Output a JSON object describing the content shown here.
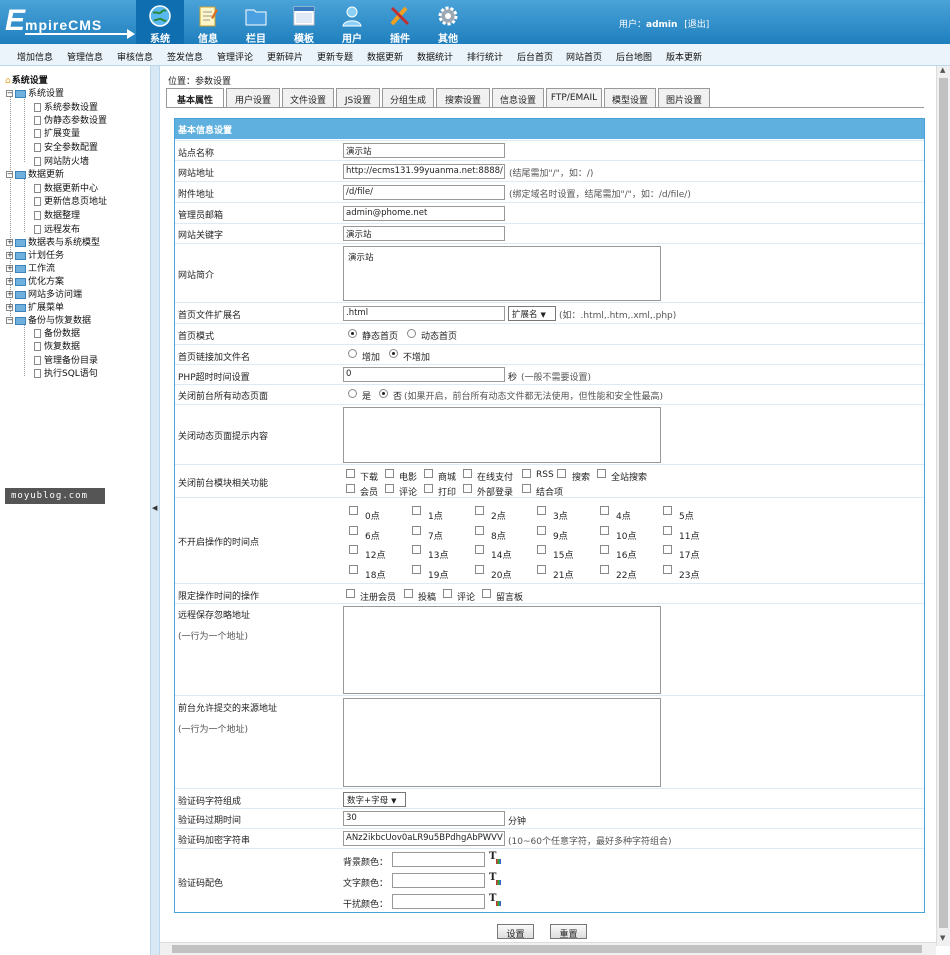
{
  "logo": {
    "big": "E",
    "small": "mpireCMS"
  },
  "topnav": [
    {
      "label": "系统",
      "icon": "globe-icon",
      "active": true
    },
    {
      "label": "信息",
      "icon": "notepad-icon"
    },
    {
      "label": "栏目",
      "icon": "folder-icon"
    },
    {
      "label": "模板",
      "icon": "window-icon"
    },
    {
      "label": "用户",
      "icon": "user-icon"
    },
    {
      "label": "插件",
      "icon": "tools-icon"
    },
    {
      "label": "其他",
      "icon": "gear-icon"
    }
  ],
  "user": {
    "prefix": "用户：",
    "name": "admin",
    "logout": "[退出]"
  },
  "menubar": [
    "增加信息",
    "管理信息",
    "审核信息",
    "签发信息",
    "管理评论",
    "更新碎片",
    "更新专题",
    "数据更新",
    "数据统计",
    "排行统计",
    "后台首页",
    "网站首页",
    "后台地图",
    "版本更新"
  ],
  "sidebar": {
    "root": "系统设置",
    "groups": [
      {
        "label": "系统设置",
        "open": true,
        "items": [
          "系统参数设置",
          "伪静态参数设置",
          "扩展变量",
          "安全参数配置",
          "网站防火墙"
        ]
      },
      {
        "label": "数据更新",
        "open": true,
        "items": [
          "数据更新中心",
          "更新信息页地址",
          "数据整理",
          "远程发布"
        ]
      },
      {
        "label": "数据表与系统模型"
      },
      {
        "label": "计划任务"
      },
      {
        "label": "工作流"
      },
      {
        "label": "优化方案"
      },
      {
        "label": "网站多访问端"
      },
      {
        "label": "扩展菜单"
      },
      {
        "label": "备份与恢复数据",
        "open": true,
        "items": [
          "备份数据",
          "恢复数据",
          "管理备份目录",
          "执行SQL语句"
        ]
      }
    ],
    "watermark": "moyublog.com"
  },
  "location": "位置：参数设置",
  "tabs": [
    "基本属性",
    "用户设置",
    "文件设置",
    "JS设置",
    "分组生成",
    "搜索设置",
    "信息设置",
    "FTP/EMAIL",
    "模型设置",
    "图片设置"
  ],
  "form": {
    "title": "基本信息设置",
    "site_name": {
      "label": "站点名称",
      "value": "演示站"
    },
    "site_url": {
      "label": "网站地址",
      "value": "http://ecms131.99yuanma.net:8888/",
      "hint": "(结尾需加\"/\"，如：/)"
    },
    "file_url": {
      "label": "附件地址",
      "value": "/d/file/",
      "hint": "(绑定域名时设置，结尾需加\"/\"，如：/d/file/)"
    },
    "email": {
      "label": "管理员邮箱",
      "value": "admin@phome.net"
    },
    "keywords": {
      "label": "网站关键字",
      "value": "演示站"
    },
    "intro": {
      "label": "网站简介",
      "value": "演示站"
    },
    "index_ext": {
      "label": "首页文件扩展名",
      "value": ".html",
      "select": "扩展名",
      "hint": "(如：.html,.htm,.xml,.php)"
    },
    "index_mode": {
      "label": "首页模式",
      "opt1": "静态首页",
      "opt2": "动态首页"
    },
    "index_link": {
      "label": "首页链接加文件名",
      "opt1": "增加",
      "opt2": "不增加"
    },
    "php_timeout": {
      "label": "PHP超时时间设置",
      "value": "0",
      "unit": "秒",
      "hint": "(一般不需要设置)"
    },
    "close_dynamic": {
      "label": "关闭前台所有动态页面",
      "opt1": "是",
      "opt2": "否",
      "hint": "(如果开启，前台所有动态文件都无法使用，但性能和安全性最高)"
    },
    "close_msg": {
      "label": "关闭动态页面提示内容"
    },
    "close_modules": {
      "label": "关闭前台模块相关功能",
      "row1": [
        "下载",
        "电影",
        "商城",
        "在线支付",
        "RSS",
        "搜索",
        "全站搜索"
      ],
      "row2": [
        "会员",
        "评论",
        "打印",
        "外部登录",
        "结合项"
      ]
    },
    "closed_hours": {
      "label": "不开启操作的时间点",
      "hours": [
        "0点",
        "1点",
        "2点",
        "3点",
        "4点",
        "5点",
        "6点",
        "7点",
        "8点",
        "9点",
        "10点",
        "11点",
        "12点",
        "13点",
        "14点",
        "15点",
        "16点",
        "17点",
        "18点",
        "19点",
        "20点",
        "21点",
        "22点",
        "23点"
      ]
    },
    "limit_ops": {
      "label": "限定操作时间的操作",
      "opts": [
        "注册会员",
        "投稿",
        "评论",
        "留言板"
      ]
    },
    "remote_ignore": {
      "label": "远程保存忽略地址",
      "sub": "(一行为一个地址)"
    },
    "allow_source": {
      "label": "前台允许提交的来源地址",
      "sub": "(一行为一个地址)"
    },
    "captcha_chars": {
      "label": "验证码字符组成",
      "select": "数字+字母"
    },
    "captcha_expire": {
      "label": "验证码过期时间",
      "value": "30",
      "unit": "分钟"
    },
    "captcha_key": {
      "label": "验证码加密字符串",
      "value": "ANz2ikbcUov0aLR9u5BPdhgAbPWVV",
      "hint": "(10~60个任意字符，最好多种字符组合)"
    },
    "captcha_colors": {
      "label": "验证码配色",
      "bg": "背景颜色：",
      "text": "文字颜色：",
      "noise": "干扰颜色："
    }
  },
  "buttons": {
    "submit": "设置",
    "reset": "重置"
  },
  "colors": {
    "accent": "#1f7fbe",
    "header": "#5fb0de"
  }
}
